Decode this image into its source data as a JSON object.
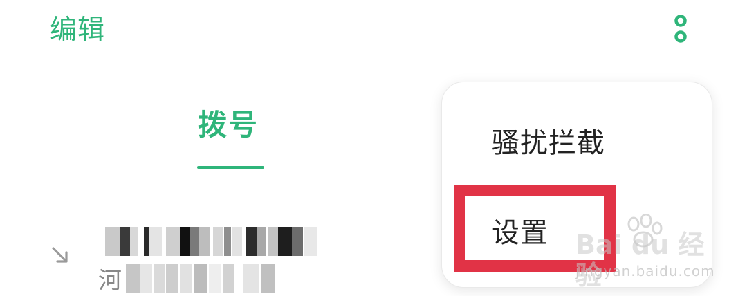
{
  "header": {
    "edit_label": "编辑",
    "overflow_icon": "more-vertical-icon",
    "accent_color": "#2fb57a"
  },
  "tabs": {
    "dial_label": "拨号"
  },
  "call_log": {
    "call_type_icon": "outgoing-call-icon",
    "location_partial": "河"
  },
  "menu": {
    "items": [
      {
        "label": "骚扰拦截"
      },
      {
        "label": "设置"
      }
    ],
    "highlight_color": "#e13346"
  },
  "watermark": {
    "logo_text": "Bai du 经验",
    "site": "jingyan.baidu.com"
  }
}
